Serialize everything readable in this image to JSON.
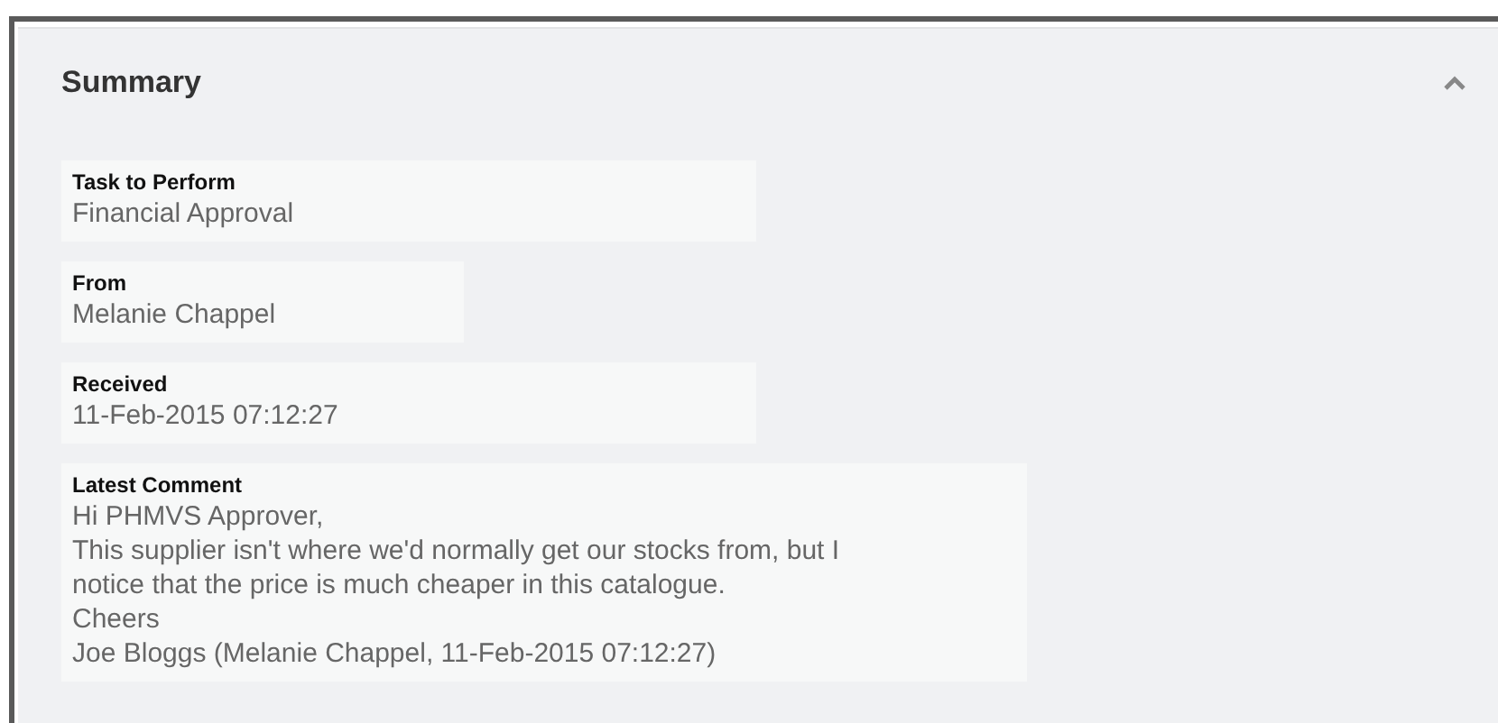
{
  "panel": {
    "title": "Summary",
    "expanded": true
  },
  "fields": [
    {
      "label": "Task to Perform",
      "lines": [
        "Financial Approval"
      ]
    },
    {
      "label": "From",
      "lines": [
        "Melanie Chappel"
      ]
    },
    {
      "label": "Received",
      "lines": [
        "11-Feb-2015 07:12:27"
      ]
    },
    {
      "label": "Latest Comment",
      "lines": [
        "Hi PHMVS Approver,",
        "This supplier isn't where we'd normally get our stocks from, but I",
        "notice that the price is much cheaper in this catalogue.",
        "Cheers",
        "Joe Bloggs (Melanie Chappel, 11-Feb-2015 07:12:27)"
      ]
    }
  ]
}
